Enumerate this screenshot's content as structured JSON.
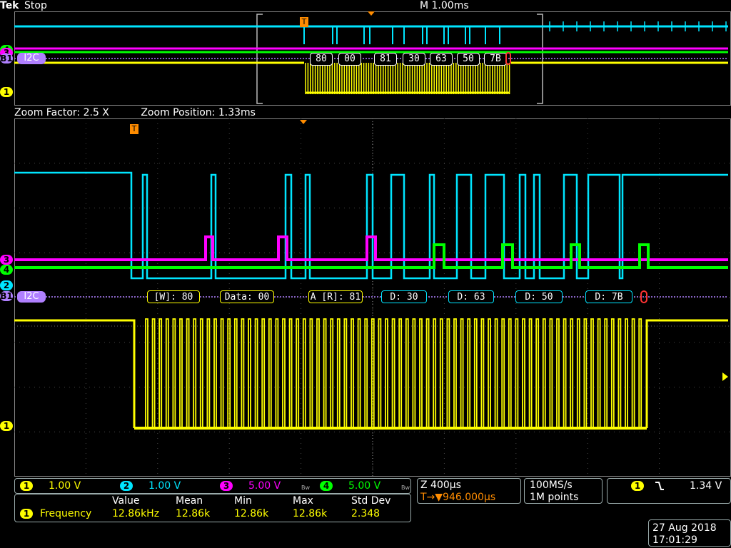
{
  "header": {
    "brand": "Tek",
    "run_state": "Stop",
    "timebase": "M 1.00ms"
  },
  "overview": {
    "trigger_marker": "T",
    "bus_label": "I2C",
    "bus_channel_tag": "B1",
    "bytes": [
      "80",
      "00",
      "81",
      "30",
      "63",
      "50",
      "7B"
    ],
    "stop_marker": "!"
  },
  "zoom_bar": {
    "zoom_factor": "Zoom Factor: 2.5 X",
    "zoom_position": "Zoom Position: 1.33ms"
  },
  "main_view": {
    "trigger_marker": "T",
    "bus_label": "I2C",
    "bus_channel_tag": "B1",
    "decoded_frames": [
      "[W]: 80",
      "Data: 00",
      "A [R]: 81",
      "D: 30",
      "D: 63",
      "D: 50",
      "D: 7B"
    ],
    "stop_marker": "!",
    "channel_tags": {
      "ch1": "1",
      "ch2": "2",
      "ch3": "3",
      "ch4": "4",
      "bus": "B1"
    }
  },
  "channels": [
    {
      "num": "1",
      "scale": "1.00 V",
      "color": "#ffff00"
    },
    {
      "num": "2",
      "scale": "1.00 V",
      "color": "#00e5ff"
    },
    {
      "num": "3",
      "scale": "5.00 V",
      "color": "#ff00ff"
    },
    {
      "num": "4",
      "scale": "5.00 V",
      "color": "#00ff00"
    }
  ],
  "bandwidth_symbol": "Bw",
  "horizontal": {
    "zoom_scale": "Z 400µs",
    "trigger_position": "T→▼946.000µs",
    "sample_rate": "100MS/s",
    "record_length": "1M points"
  },
  "trigger": {
    "channel": "1",
    "slope_icon": "falling-edge-icon",
    "level": "1.34 V"
  },
  "measurements": {
    "headers": [
      "Value",
      "Mean",
      "Min",
      "Max",
      "Std Dev"
    ],
    "rows": [
      {
        "channel": "1",
        "name": "Frequency",
        "value": "12.86kHz",
        "mean": "12.86k",
        "min": "12.86k",
        "max": "12.86k",
        "std_dev": "2.348"
      }
    ]
  },
  "datetime": {
    "date": "27 Aug 2018",
    "time": "17:01:29"
  },
  "colors": {
    "ch1": "#ffff00",
    "ch2": "#00e5ff",
    "ch3": "#ff00ff",
    "ch4": "#00ff00",
    "trigger": "#ff8c00",
    "bus": "#b080ff",
    "frame_text": "#ffffff"
  }
}
